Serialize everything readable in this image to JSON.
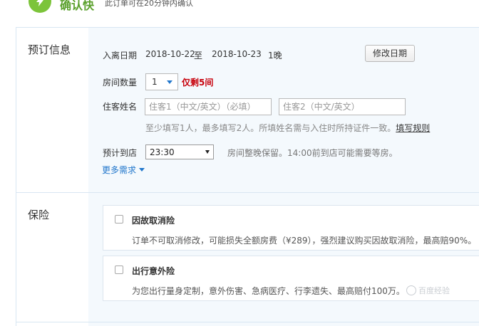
{
  "top": {
    "title": "确认快",
    "note": "此订单可在20分钟内确认"
  },
  "booking": {
    "section_title": "预订信息",
    "stay": {
      "label": "入离日期",
      "checkin": "2018-10-22",
      "to": "至",
      "checkout": "2018-10-23",
      "nights": "1晚",
      "edit_button": "修改日期"
    },
    "rooms": {
      "label": "房间数量",
      "value": "1",
      "remaining": "仅剩5间"
    },
    "guests": {
      "label": "住客姓名",
      "guest1_placeholder": "住客1（中文/英文）（必填）",
      "guest2_placeholder": "住客2（中文/英文）",
      "hint": "至少填写1人，最多填写2人。所填姓名需与入住时所持证件一致。",
      "rules_link": "填写规则"
    },
    "arrival": {
      "label": "预计到店",
      "value": "23:30",
      "note": "房间整晚保留。14:00前到店可能需要等房。"
    },
    "more_label": "更多需求"
  },
  "insurance": {
    "section_title": "保险",
    "items": [
      {
        "name": "因故取消险",
        "desc": "订单不可取消修改，可能损失全额房费（¥289），强烈建议购买因故取消险，最高赔90%。"
      },
      {
        "name": "出行意外险",
        "desc": "为您出行量身定制，意外伤害、急病医疗、行李遗失、最高赔付100万。"
      }
    ]
  },
  "watermark": "百度经验",
  "colors": {
    "accent_blue": "#2277cc",
    "alert_red": "#c7000b",
    "brand_green": "#7cc43a",
    "content_bg": "#f4f9fd"
  }
}
